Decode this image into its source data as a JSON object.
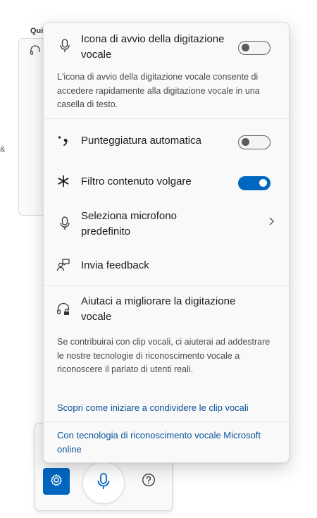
{
  "background": {
    "title": "Qui",
    "edge_glyph": "&"
  },
  "panel": {
    "launcher_icon": {
      "label": "Icona di avvio della digitazione vocale",
      "enabled": false,
      "description": "L'icona di avvio della digitazione vocale consente di accedere rapidamente alla digitazione vocale in una casella di testo."
    },
    "auto_punctuation": {
      "label": "Punteggiatura automatica",
      "enabled": false
    },
    "profanity_filter": {
      "label": "Filtro contenuto volgare",
      "enabled": true
    },
    "default_microphone": {
      "label": "Seleziona microfono predefinito"
    },
    "feedback": {
      "label": "Invia feedback"
    },
    "improve": {
      "label": "Aiutaci a migliorare la digitazione vocale",
      "description": "Se contribuirai con clip vocali, ci aiuterai ad addestrare le nostre tecnologie di riconoscimento vocale a riconoscere il parlato di utenti reali.",
      "link": "Scopri come iniziare a condividere le clip vocali"
    },
    "footer_link": "Con tecnologia di riconoscimento vocale Microsoft online"
  },
  "toolbar": {
    "settings_icon": "gear-icon",
    "mic_icon": "microphone-icon",
    "help_icon": "help-icon"
  },
  "colors": {
    "accent": "#0067c0",
    "link": "#0a5299"
  }
}
